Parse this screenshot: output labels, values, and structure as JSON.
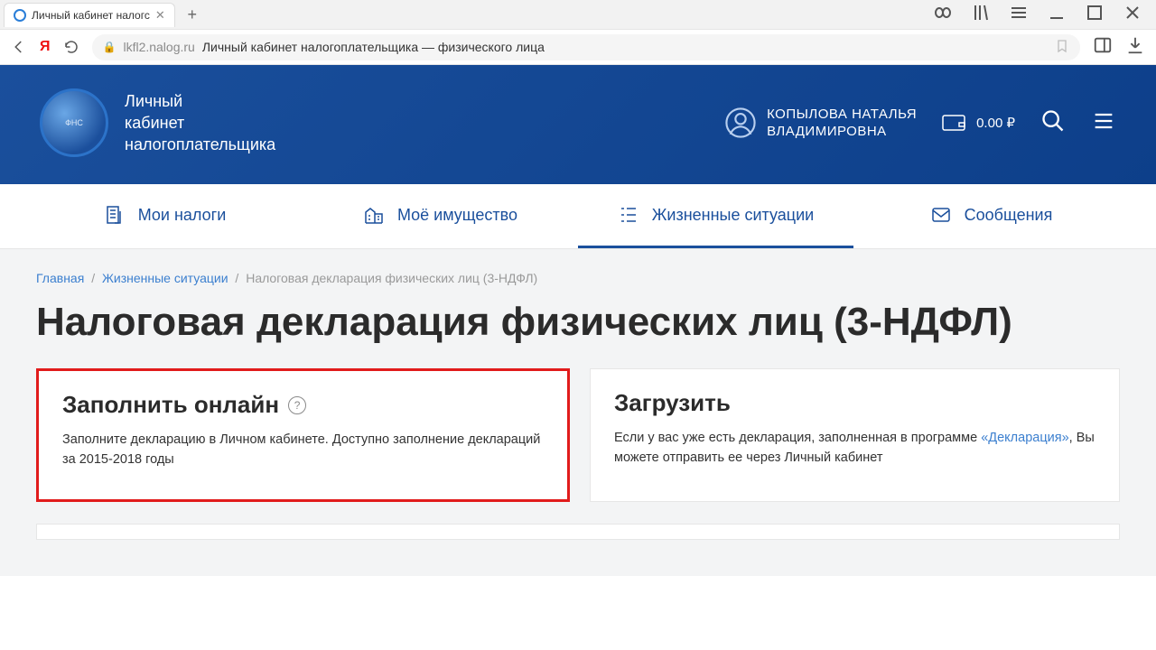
{
  "browser": {
    "tab_title": "Личный кабинет налогс",
    "url_host": "lkfl2.nalog.ru",
    "url_label": "Личный кабинет налогоплательщика — физического лица"
  },
  "header": {
    "title_line1": "Личный",
    "title_line2": "кабинет",
    "title_line3": "налогоплательщика",
    "user_name_line1": "КОПЫЛОВА НАТАЛЬЯ",
    "user_name_line2": "ВЛАДИМИРОВНА",
    "balance": "0.00 ₽"
  },
  "nav": {
    "items": [
      {
        "label": "Мои налоги"
      },
      {
        "label": "Моё имущество"
      },
      {
        "label": "Жизненные ситуации"
      },
      {
        "label": "Сообщения"
      }
    ]
  },
  "breadcrumbs": {
    "home": "Главная",
    "second": "Жизненные ситуации",
    "current": "Налоговая декларация физических лиц (3-НДФЛ)"
  },
  "page_title": "Налоговая декларация физических лиц (3-НДФЛ)",
  "cards": {
    "fill": {
      "title": "Заполнить онлайн",
      "desc": "Заполните декларацию в Личном кабинете. Доступно заполнение деклараций за 2015-2018 годы"
    },
    "upload": {
      "title": "Загрузить",
      "desc_before": "Если у вас уже есть декларация, заполненная в программе ",
      "desc_link": "«Декларация»",
      "desc_after": ", Вы можете отправить ее через Личный кабинет"
    }
  }
}
